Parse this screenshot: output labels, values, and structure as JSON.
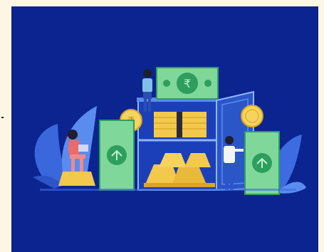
{
  "illustration": {
    "subject": "finance-vault-illustration",
    "colors": {
      "page_background": "#FDF6E3",
      "panel_background": "#0C2490",
      "cash_green": "#7FD89A",
      "cash_dark_green": "#2E9E5E",
      "gold": "#F2C94C",
      "gold_dark": "#D9A521",
      "vault_blue": "#5A8CF0",
      "vault_outline": "#8EB6FF",
      "plant_blue": "#3D6BE0",
      "coin_yellow": "#F6D35C"
    },
    "icons": {
      "banknote_top_symbol": "rupee-icon",
      "left_coin_symbol": "rupee-icon"
    }
  }
}
